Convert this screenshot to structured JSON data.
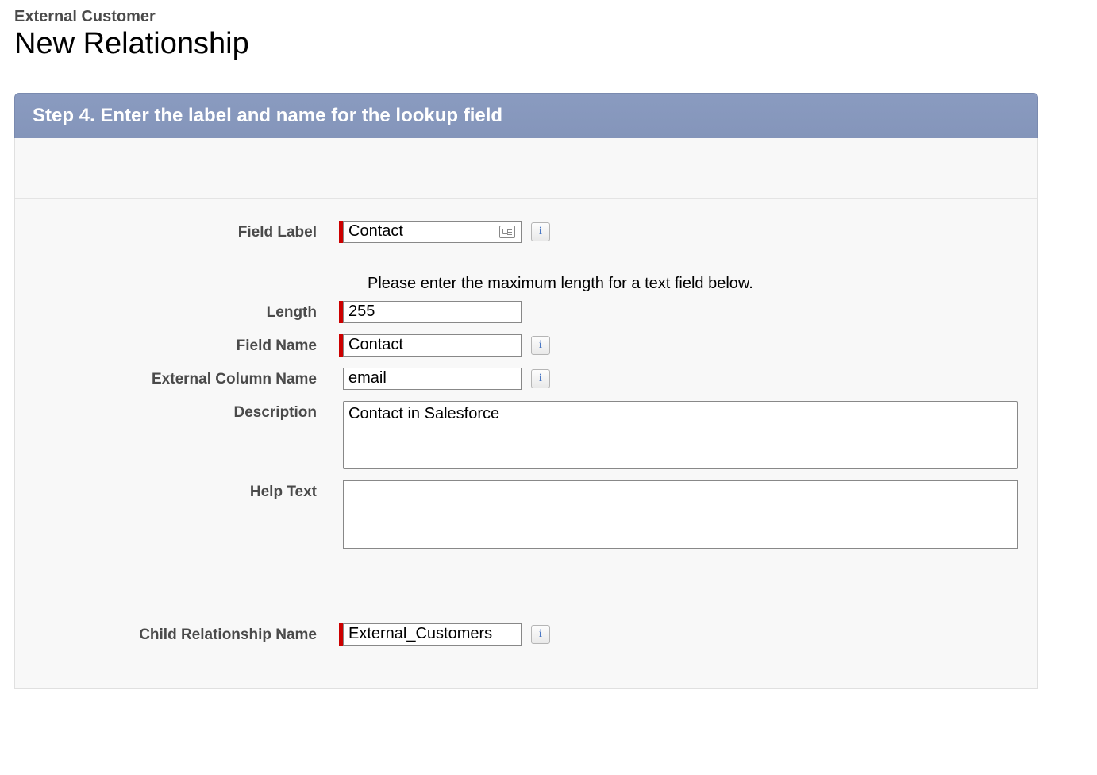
{
  "header": {
    "breadcrumb": "External Customer",
    "title": "New Relationship"
  },
  "panel": {
    "step_title": "Step 4. Enter the label and name for the lookup field"
  },
  "form": {
    "field_label": {
      "label": "Field Label",
      "value": "Contact"
    },
    "length_hint": "Please enter the maximum length for a text field below.",
    "length": {
      "label": "Length",
      "value": "255"
    },
    "field_name": {
      "label": "Field Name",
      "value": "Contact"
    },
    "external_column": {
      "label": "External Column Name",
      "value": "email"
    },
    "description": {
      "label": "Description",
      "value": "Contact in Salesforce"
    },
    "help_text": {
      "label": "Help Text",
      "value": ""
    },
    "child_rel": {
      "label": "Child Relationship Name",
      "value": "External_Customers"
    }
  }
}
